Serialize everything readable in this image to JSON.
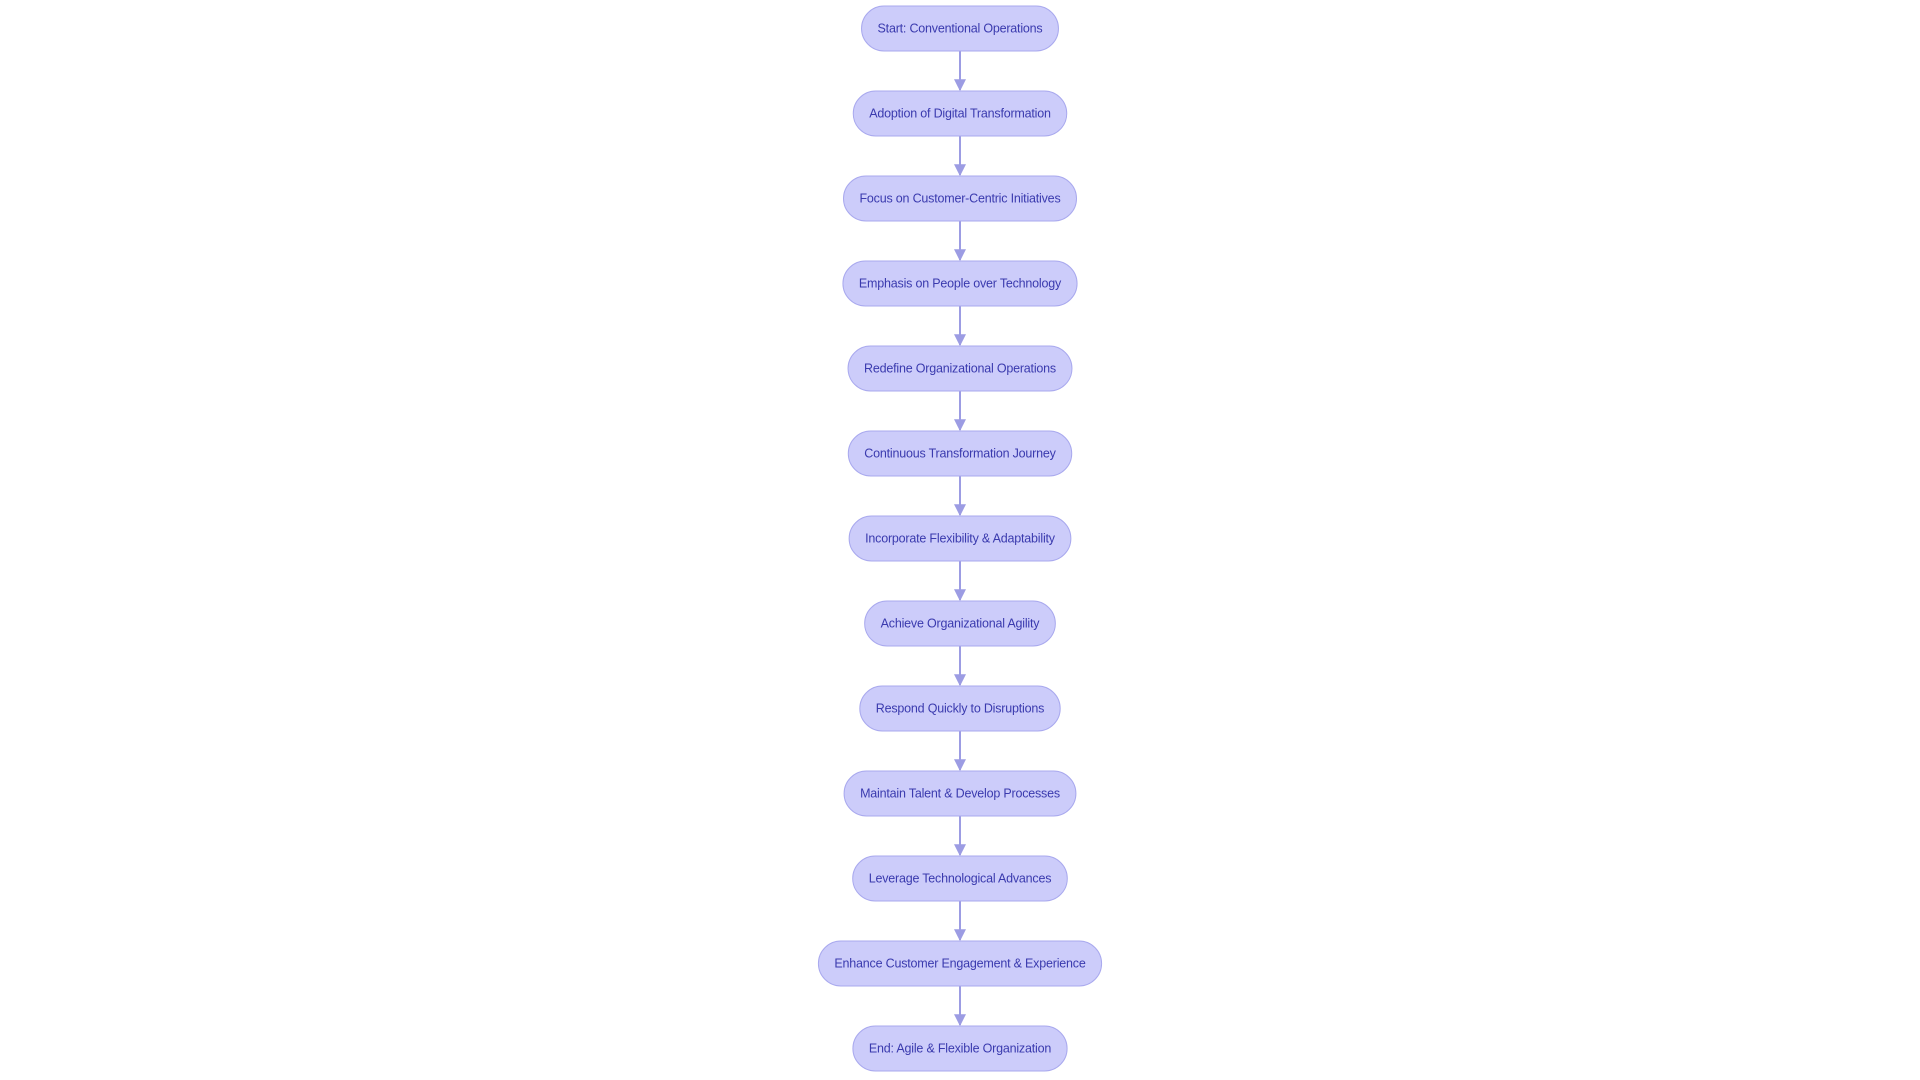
{
  "diagram": {
    "type": "flowchart",
    "direction": "top-to-bottom",
    "colors": {
      "background": "#ffffff",
      "node_fill": "#CCCCFA",
      "node_stroke": "#A9A9EE",
      "node_text": "#3A3AAE",
      "edge": "#9C9CE3"
    },
    "nodes": [
      {
        "id": "n1",
        "label": "Start: Conventional Operations"
      },
      {
        "id": "n2",
        "label": "Adoption of Digital Transformation"
      },
      {
        "id": "n3",
        "label": "Focus on Customer-Centric Initiatives"
      },
      {
        "id": "n4",
        "label": "Emphasis on People over Technology"
      },
      {
        "id": "n5",
        "label": "Redefine Organizational Operations"
      },
      {
        "id": "n6",
        "label": "Continuous Transformation Journey"
      },
      {
        "id": "n7",
        "label": "Incorporate Flexibility & Adaptability"
      },
      {
        "id": "n8",
        "label": "Achieve Organizational Agility"
      },
      {
        "id": "n9",
        "label": "Respond Quickly to Disruptions"
      },
      {
        "id": "n10",
        "label": "Maintain Talent & Develop Processes"
      },
      {
        "id": "n11",
        "label": "Leverage Technological Advances"
      },
      {
        "id": "n12",
        "label": "Enhance Customer Engagement & Experience"
      },
      {
        "id": "n13",
        "label": "End: Agile & Flexible Organization"
      }
    ],
    "edges": [
      {
        "from": "n1",
        "to": "n2"
      },
      {
        "from": "n2",
        "to": "n3"
      },
      {
        "from": "n3",
        "to": "n4"
      },
      {
        "from": "n4",
        "to": "n5"
      },
      {
        "from": "n5",
        "to": "n6"
      },
      {
        "from": "n6",
        "to": "n7"
      },
      {
        "from": "n7",
        "to": "n8"
      },
      {
        "from": "n8",
        "to": "n9"
      },
      {
        "from": "n9",
        "to": "n10"
      },
      {
        "from": "n10",
        "to": "n11"
      },
      {
        "from": "n11",
        "to": "n12"
      },
      {
        "from": "n12",
        "to": "n13"
      }
    ]
  }
}
